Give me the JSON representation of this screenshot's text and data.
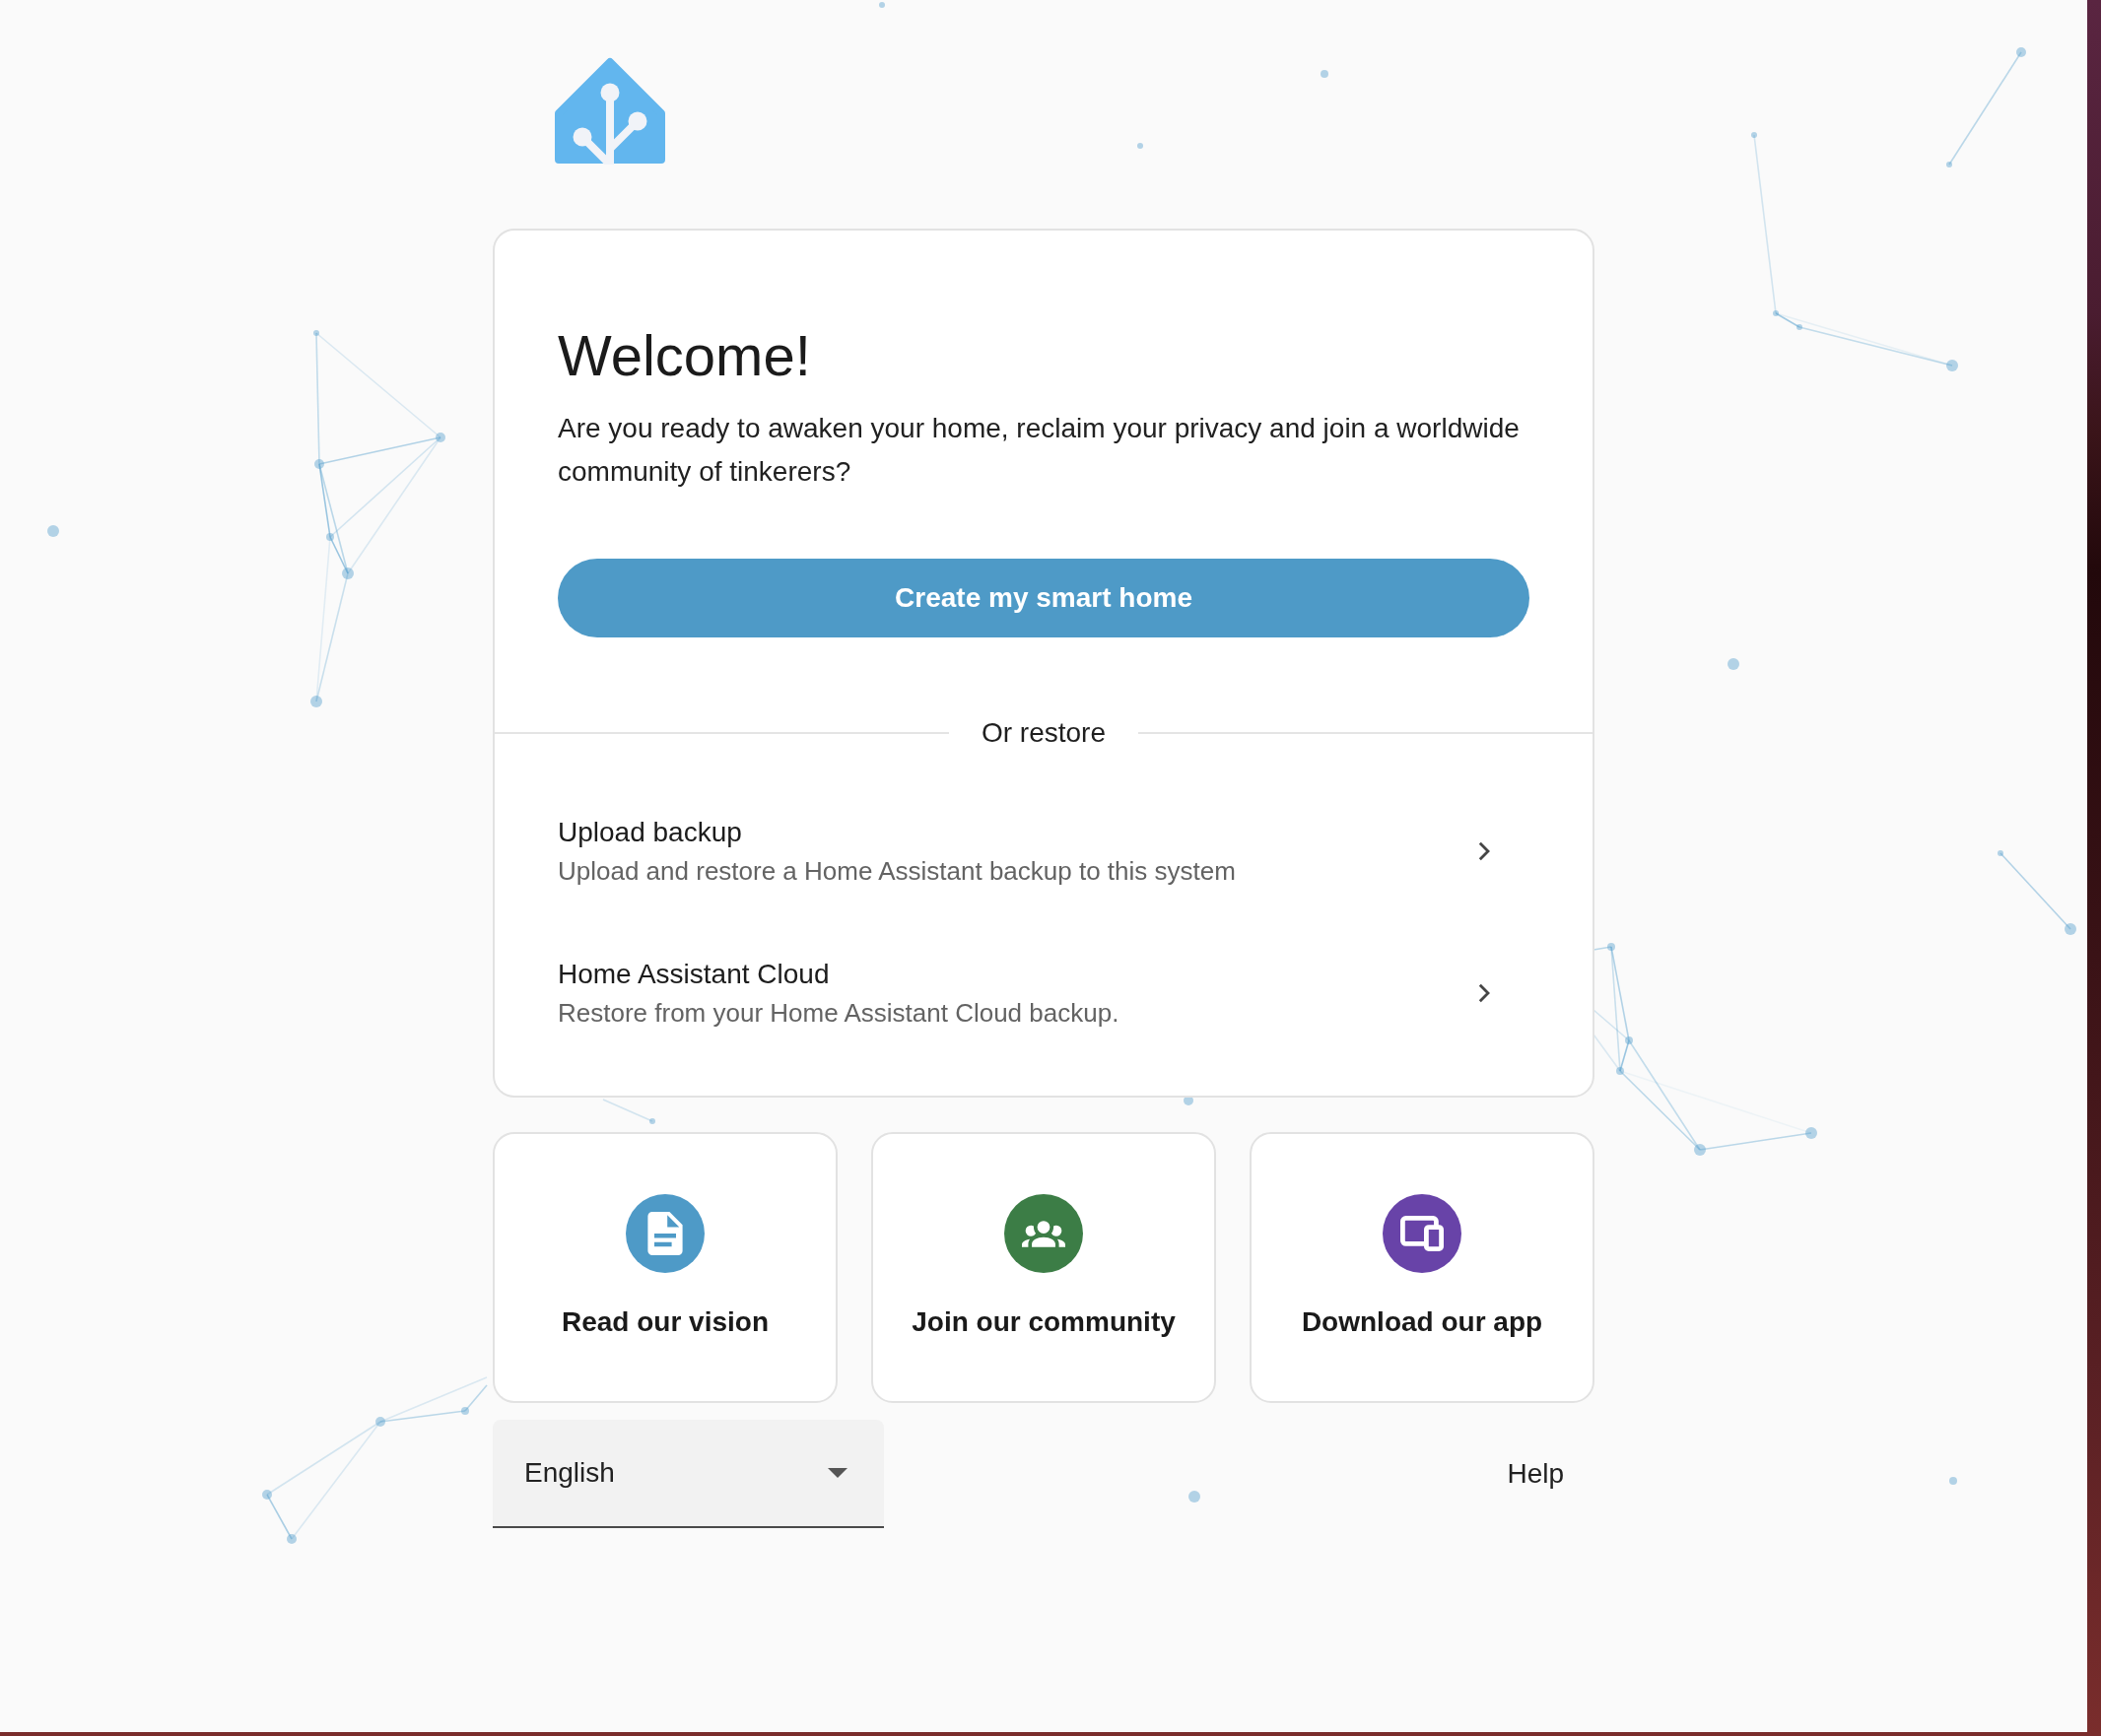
{
  "welcome": {
    "title": "Welcome!",
    "text": "Are you ready to awaken your home, reclaim your privacy and join a worldwide community of tinkerers?"
  },
  "create_button": {
    "label": "Create my smart home"
  },
  "restore": {
    "divider_label": "Or restore",
    "options": [
      {
        "title": "Upload backup",
        "description": "Upload and restore a Home Assistant backup to this system"
      },
      {
        "title": "Home Assistant Cloud",
        "description": "Restore from your Home Assistant Cloud backup."
      }
    ]
  },
  "links": [
    {
      "label": "Read our vision",
      "color": "#4e9ac7"
    },
    {
      "label": "Join our community",
      "color": "#3c7d46"
    },
    {
      "label": "Download our app",
      "color": "#6843a8"
    }
  ],
  "footer": {
    "language": {
      "value": "English"
    },
    "help": "Help"
  }
}
